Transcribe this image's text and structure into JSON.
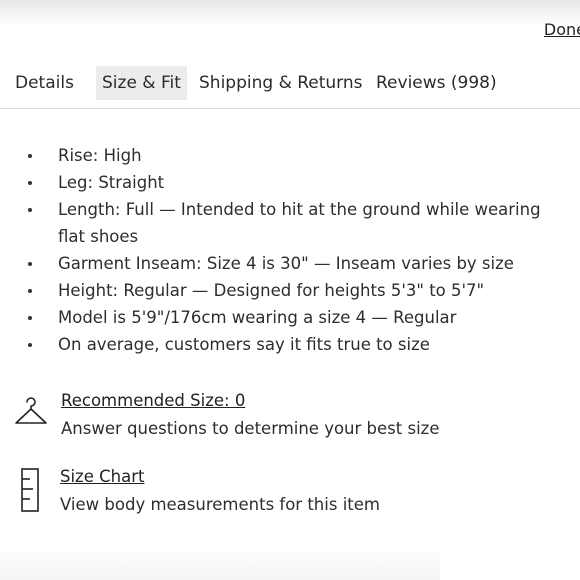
{
  "header": {
    "done_label": "Done"
  },
  "tabs": [
    {
      "label": "Details",
      "active": false
    },
    {
      "label": "Size & Fit",
      "active": true
    },
    {
      "label": "Shipping & Returns",
      "active": false
    },
    {
      "label": "Reviews (998)",
      "active": false
    }
  ],
  "fit_details": [
    "Rise: High",
    "Leg: Straight",
    "Length: Full — Intended to hit at the ground while wearing flat shoes",
    "Garment Inseam: Size 4 is 30\" — Inseam varies by size",
    "Height: Regular — Designed for heights 5'3\" to 5'7\"",
    "Model is 5'9\"/176cm wearing a size 4  —  Regular",
    "On average, customers say it fits true to size"
  ],
  "recommended": {
    "icon": "hanger-icon",
    "title": "Recommended Size: 0",
    "subtitle": "Answer questions to determine your best size"
  },
  "size_chart": {
    "icon": "ruler-icon",
    "title": "Size Chart",
    "subtitle": "View body measurements for this item"
  },
  "colors": {
    "active_tab_bg": "#ececec",
    "text": "#2a2a2a",
    "divider": "#dcdcdc"
  }
}
